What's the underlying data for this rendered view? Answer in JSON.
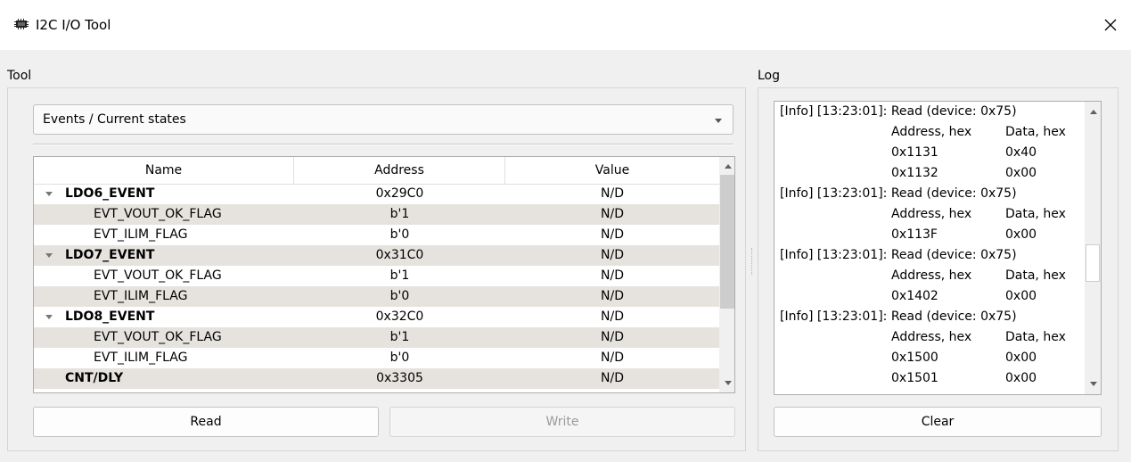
{
  "window": {
    "title": "I2C I/O Tool",
    "icon": "chip-icon",
    "close_icon": "close-icon"
  },
  "tool": {
    "label": "Tool",
    "combo": {
      "value": "Events / Current states"
    },
    "table": {
      "headers": {
        "name": "Name",
        "address": "Address",
        "value": "Value"
      },
      "rows": [
        {
          "name": "LDO6_EVENT",
          "address": "0x29C0",
          "value": "N/D"
        },
        {
          "name": "EVT_VOUT_OK_FLAG",
          "address": "b'1",
          "value": "N/D"
        },
        {
          "name": "EVT_ILIM_FLAG",
          "address": "b'0",
          "value": "N/D"
        },
        {
          "name": "LDO7_EVENT",
          "address": "0x31C0",
          "value": "N/D"
        },
        {
          "name": "EVT_VOUT_OK_FLAG",
          "address": "b'1",
          "value": "N/D"
        },
        {
          "name": "EVT_ILIM_FLAG",
          "address": "b'0",
          "value": "N/D"
        },
        {
          "name": "LDO8_EVENT",
          "address": "0x32C0",
          "value": "N/D"
        },
        {
          "name": "EVT_VOUT_OK_FLAG",
          "address": "b'1",
          "value": "N/D"
        },
        {
          "name": "EVT_ILIM_FLAG",
          "address": "b'0",
          "value": "N/D"
        },
        {
          "name": "CNT/DLY",
          "address": "0x3305",
          "value": "N/D"
        }
      ]
    },
    "read_label": "Read",
    "write_label": "Write"
  },
  "log": {
    "label": "Log",
    "entries": [
      {
        "header": "[Info] [13:23:01]: Read (device: 0x75)",
        "col_addr": "Address, hex",
        "col_data": "Data, hex",
        "pairs": [
          {
            "addr": "0x1131",
            "data": "0x40"
          },
          {
            "addr": "0x1132",
            "data": "0x00"
          }
        ]
      },
      {
        "header": "[Info] [13:23:01]: Read (device: 0x75)",
        "col_addr": "Address, hex",
        "col_data": "Data, hex",
        "pairs": [
          {
            "addr": "0x113F",
            "data": "0x00"
          }
        ]
      },
      {
        "header": "[Info] [13:23:01]: Read (device: 0x75)",
        "col_addr": "Address, hex",
        "col_data": "Data, hex",
        "pairs": [
          {
            "addr": "0x1402",
            "data": "0x00"
          }
        ]
      },
      {
        "header": "[Info] [13:23:01]: Read (device: 0x75)",
        "col_addr": "Address, hex",
        "col_data": "Data, hex",
        "pairs": [
          {
            "addr": "0x1500",
            "data": "0x00"
          },
          {
            "addr": "0x1501",
            "data": "0x00"
          }
        ]
      }
    ],
    "clear_label": "Clear"
  }
}
